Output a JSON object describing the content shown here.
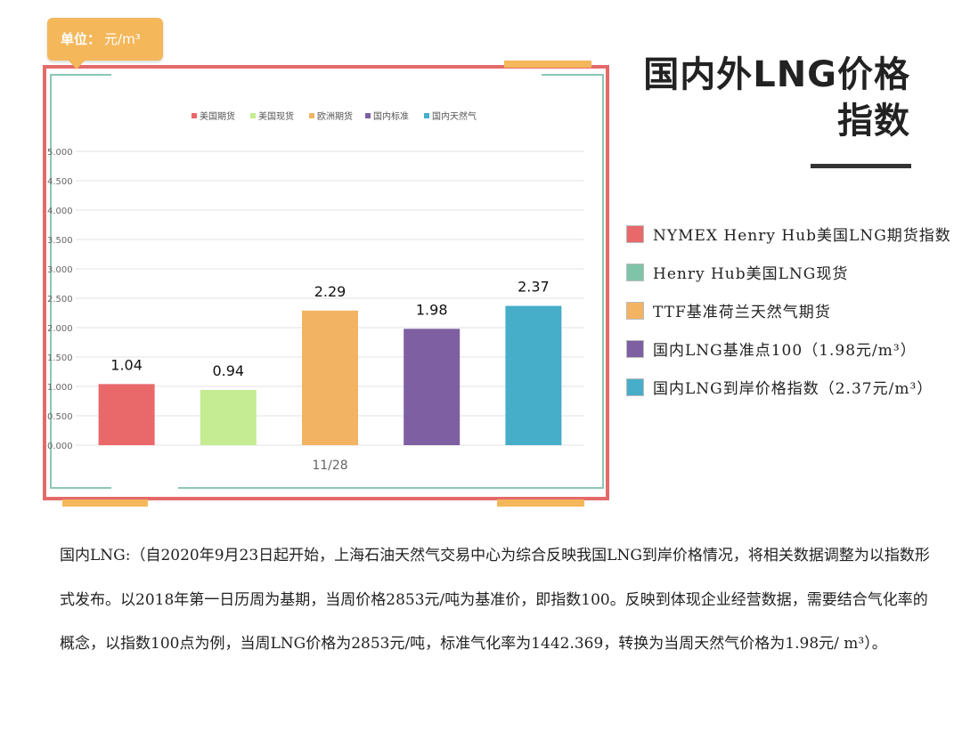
{
  "unit_tag": {
    "label": "单位：",
    "value": "元/m³"
  },
  "title": "国内外LNG价格指数",
  "chart_data": {
    "type": "bar",
    "categories": [
      "美国期货",
      "美国现货",
      "欧洲期货",
      "国内标准",
      "国内天然气"
    ],
    "values": [
      1.04,
      0.94,
      2.29,
      1.98,
      2.37
    ],
    "value_labels": [
      "1.04",
      "0.94",
      "2.29",
      "1.98",
      "2.37"
    ],
    "colors": [
      "#e9686a",
      "#c5ec93",
      "#f2b463",
      "#7e5fa2",
      "#46aec8"
    ],
    "x_label": "11/28",
    "ylim": [
      0,
      5
    ],
    "y_ticks": [
      "0.000",
      "0.500",
      "1.000",
      "1.500",
      "2.000",
      "2.500",
      "3.000",
      "3.500",
      "4.000",
      "4.500",
      "5.000"
    ],
    "legend_position": "top",
    "grid": true
  },
  "descriptions": [
    {
      "text": "NYMEX Henry Hub美国LNG期货指数",
      "color": "#e9686a"
    },
    {
      "text": "Henry Hub美国LNG现货",
      "color": "#7fc4a8"
    },
    {
      "text": "TTF基准荷兰天然气期货",
      "color": "#f2b463"
    },
    {
      "text": "国内LNG基准点100（1.98元/m³）",
      "color": "#7e5fa2"
    },
    {
      "text": "国内LNG到岸价格指数（2.37元/m³）",
      "color": "#46aec8"
    }
  ],
  "paragraph": "国内LNG:（自2020年9月23日起开始，上海石油天然气交易中心为综合反映我国LNG到岸价格情况，将相关数据调整为以指数形式发布。以2018年第一日历周为基期，当周价格2853元/吨为基准价，即指数100。反映到体现企业经营数据，需要结合气化率的概念，以指数100点为例，当周LNG价格为2853元/吨，标准气化率为1442.369，转换为当周天然气价格为1.98元/ m³）。"
}
